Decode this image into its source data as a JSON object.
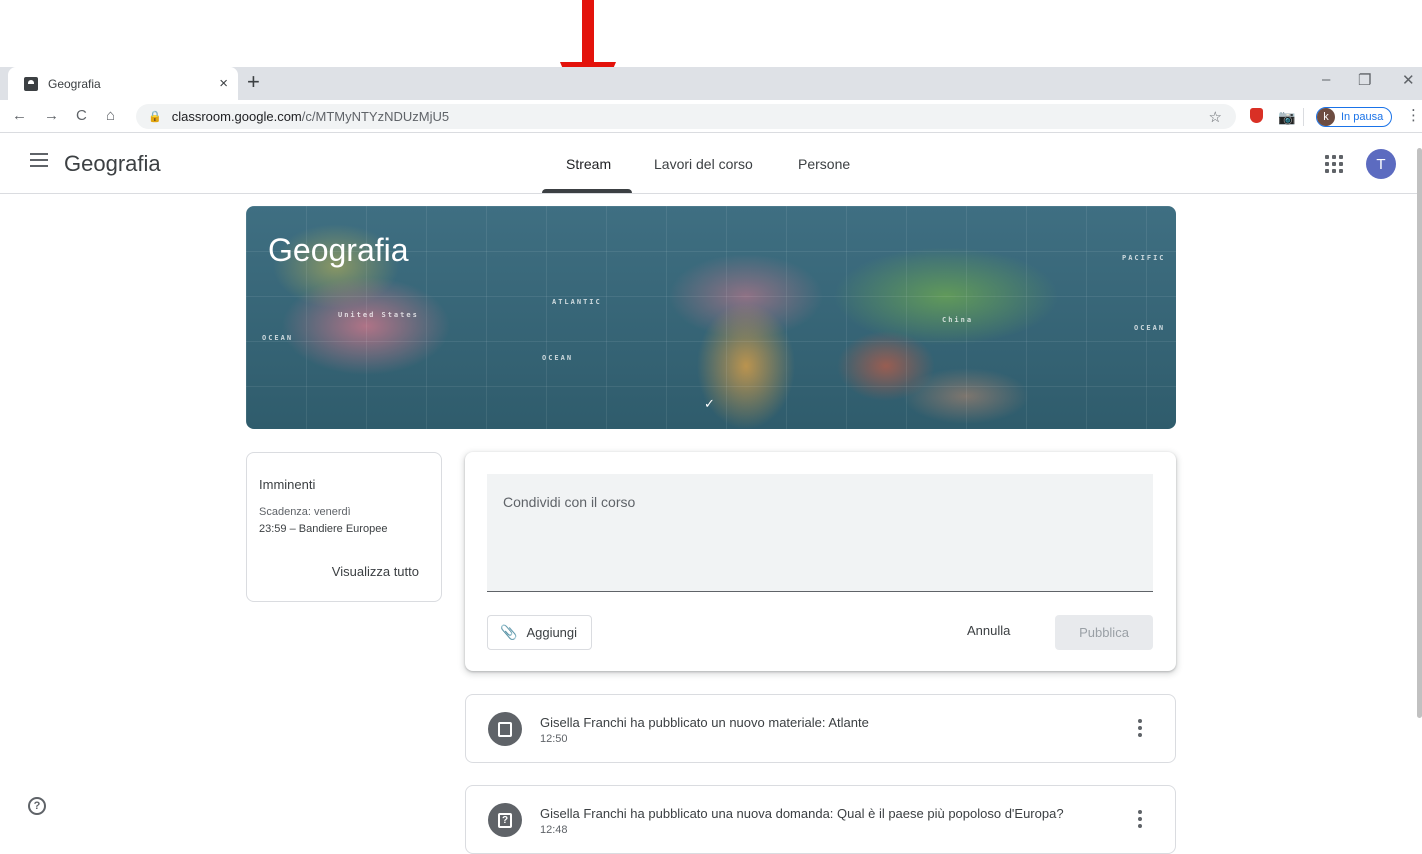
{
  "browser": {
    "tab_title": "Geografia",
    "tab_close": "×",
    "new_tab": "+",
    "window_controls": {
      "minimize": "–",
      "restore": "❐",
      "close": "✕"
    },
    "nav": {
      "back": "←",
      "forward": "→",
      "reload": "C",
      "home": "⌂"
    },
    "url_host": "classroom.google.com",
    "url_path": "/c/MTMyNTYzNDUzMjU5",
    "profile_initial": "k",
    "profile_status": "In pausa",
    "menu": "⋮"
  },
  "classroom": {
    "app_title": "Geografia",
    "tabs": [
      {
        "label": "Stream",
        "active": true
      },
      {
        "label": "Lavori del corso",
        "active": false
      },
      {
        "label": "Persone",
        "active": false
      }
    ],
    "user_initial": "T"
  },
  "banner": {
    "course_title": "Geografia",
    "map_labels": [
      "PACIFIC",
      "ATLANTIC",
      "United States",
      "OCEAN",
      "OCEAN",
      "OCEAN",
      "China"
    ],
    "expand_icon": "chevron-down-icon"
  },
  "upcoming": {
    "title": "Imminenti",
    "due_label": "Scadenza: venerdì",
    "due_item": "23:59 – Bandiere Europee",
    "view_all": "Visualizza tutto"
  },
  "composer": {
    "placeholder": "Condividi con il corso",
    "attach_label": "Aggiungi",
    "cancel_label": "Annulla",
    "publish_label": "Pubblica"
  },
  "stream": [
    {
      "icon": "material-icon",
      "text": "Gisella Franchi ha pubblicato un nuovo materiale: Atlante",
      "time": "12:50"
    },
    {
      "icon": "question-icon",
      "text": "Gisella Franchi ha pubblicato una nuova domanda: Qual è il paese più popoloso d'Europa?",
      "time": "12:48"
    }
  ],
  "help_icon": "?",
  "colors": {
    "annotation_arrow": "#e3120b",
    "accent": "#1a73e8",
    "avatar": "#5c6bc0"
  }
}
